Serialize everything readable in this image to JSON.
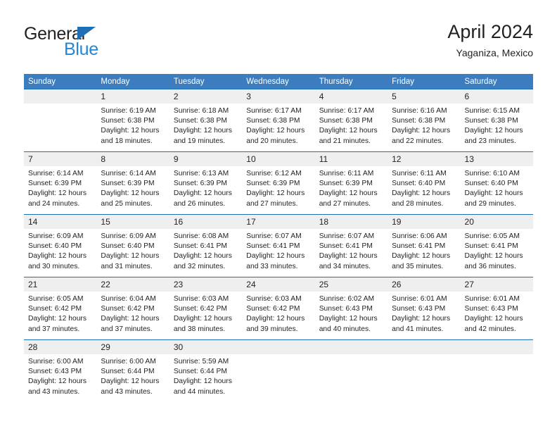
{
  "brand": {
    "name_top": "General",
    "name_bottom": "Blue",
    "triangle_color": "#1f6fb5",
    "blue_text_color": "#2387d6"
  },
  "header": {
    "title": "April 2024",
    "subtitle": "Yaganiza, Mexico"
  },
  "theme": {
    "header_row_bg": "#3b7dbf",
    "week_separator": "#1f6fb5",
    "daynum_bg": "#efefef",
    "text": "#231f20"
  },
  "weekday_headers": [
    "Sunday",
    "Monday",
    "Tuesday",
    "Wednesday",
    "Thursday",
    "Friday",
    "Saturday"
  ],
  "weeks": [
    [
      {
        "day": "",
        "sunrise": "",
        "sunset": "",
        "daylight_line1": "",
        "daylight_line2": ""
      },
      {
        "day": "1",
        "sunrise": "Sunrise: 6:19 AM",
        "sunset": "Sunset: 6:38 PM",
        "daylight_line1": "Daylight: 12 hours",
        "daylight_line2": "and 18 minutes."
      },
      {
        "day": "2",
        "sunrise": "Sunrise: 6:18 AM",
        "sunset": "Sunset: 6:38 PM",
        "daylight_line1": "Daylight: 12 hours",
        "daylight_line2": "and 19 minutes."
      },
      {
        "day": "3",
        "sunrise": "Sunrise: 6:17 AM",
        "sunset": "Sunset: 6:38 PM",
        "daylight_line1": "Daylight: 12 hours",
        "daylight_line2": "and 20 minutes."
      },
      {
        "day": "4",
        "sunrise": "Sunrise: 6:17 AM",
        "sunset": "Sunset: 6:38 PM",
        "daylight_line1": "Daylight: 12 hours",
        "daylight_line2": "and 21 minutes."
      },
      {
        "day": "5",
        "sunrise": "Sunrise: 6:16 AM",
        "sunset": "Sunset: 6:38 PM",
        "daylight_line1": "Daylight: 12 hours",
        "daylight_line2": "and 22 minutes."
      },
      {
        "day": "6",
        "sunrise": "Sunrise: 6:15 AM",
        "sunset": "Sunset: 6:38 PM",
        "daylight_line1": "Daylight: 12 hours",
        "daylight_line2": "and 23 minutes."
      }
    ],
    [
      {
        "day": "7",
        "sunrise": "Sunrise: 6:14 AM",
        "sunset": "Sunset: 6:39 PM",
        "daylight_line1": "Daylight: 12 hours",
        "daylight_line2": "and 24 minutes."
      },
      {
        "day": "8",
        "sunrise": "Sunrise: 6:14 AM",
        "sunset": "Sunset: 6:39 PM",
        "daylight_line1": "Daylight: 12 hours",
        "daylight_line2": "and 25 minutes."
      },
      {
        "day": "9",
        "sunrise": "Sunrise: 6:13 AM",
        "sunset": "Sunset: 6:39 PM",
        "daylight_line1": "Daylight: 12 hours",
        "daylight_line2": "and 26 minutes."
      },
      {
        "day": "10",
        "sunrise": "Sunrise: 6:12 AM",
        "sunset": "Sunset: 6:39 PM",
        "daylight_line1": "Daylight: 12 hours",
        "daylight_line2": "and 27 minutes."
      },
      {
        "day": "11",
        "sunrise": "Sunrise: 6:11 AM",
        "sunset": "Sunset: 6:39 PM",
        "daylight_line1": "Daylight: 12 hours",
        "daylight_line2": "and 27 minutes."
      },
      {
        "day": "12",
        "sunrise": "Sunrise: 6:11 AM",
        "sunset": "Sunset: 6:40 PM",
        "daylight_line1": "Daylight: 12 hours",
        "daylight_line2": "and 28 minutes."
      },
      {
        "day": "13",
        "sunrise": "Sunrise: 6:10 AM",
        "sunset": "Sunset: 6:40 PM",
        "daylight_line1": "Daylight: 12 hours",
        "daylight_line2": "and 29 minutes."
      }
    ],
    [
      {
        "day": "14",
        "sunrise": "Sunrise: 6:09 AM",
        "sunset": "Sunset: 6:40 PM",
        "daylight_line1": "Daylight: 12 hours",
        "daylight_line2": "and 30 minutes."
      },
      {
        "day": "15",
        "sunrise": "Sunrise: 6:09 AM",
        "sunset": "Sunset: 6:40 PM",
        "daylight_line1": "Daylight: 12 hours",
        "daylight_line2": "and 31 minutes."
      },
      {
        "day": "16",
        "sunrise": "Sunrise: 6:08 AM",
        "sunset": "Sunset: 6:41 PM",
        "daylight_line1": "Daylight: 12 hours",
        "daylight_line2": "and 32 minutes."
      },
      {
        "day": "17",
        "sunrise": "Sunrise: 6:07 AM",
        "sunset": "Sunset: 6:41 PM",
        "daylight_line1": "Daylight: 12 hours",
        "daylight_line2": "and 33 minutes."
      },
      {
        "day": "18",
        "sunrise": "Sunrise: 6:07 AM",
        "sunset": "Sunset: 6:41 PM",
        "daylight_line1": "Daylight: 12 hours",
        "daylight_line2": "and 34 minutes."
      },
      {
        "day": "19",
        "sunrise": "Sunrise: 6:06 AM",
        "sunset": "Sunset: 6:41 PM",
        "daylight_line1": "Daylight: 12 hours",
        "daylight_line2": "and 35 minutes."
      },
      {
        "day": "20",
        "sunrise": "Sunrise: 6:05 AM",
        "sunset": "Sunset: 6:41 PM",
        "daylight_line1": "Daylight: 12 hours",
        "daylight_line2": "and 36 minutes."
      }
    ],
    [
      {
        "day": "21",
        "sunrise": "Sunrise: 6:05 AM",
        "sunset": "Sunset: 6:42 PM",
        "daylight_line1": "Daylight: 12 hours",
        "daylight_line2": "and 37 minutes."
      },
      {
        "day": "22",
        "sunrise": "Sunrise: 6:04 AM",
        "sunset": "Sunset: 6:42 PM",
        "daylight_line1": "Daylight: 12 hours",
        "daylight_line2": "and 37 minutes."
      },
      {
        "day": "23",
        "sunrise": "Sunrise: 6:03 AM",
        "sunset": "Sunset: 6:42 PM",
        "daylight_line1": "Daylight: 12 hours",
        "daylight_line2": "and 38 minutes."
      },
      {
        "day": "24",
        "sunrise": "Sunrise: 6:03 AM",
        "sunset": "Sunset: 6:42 PM",
        "daylight_line1": "Daylight: 12 hours",
        "daylight_line2": "and 39 minutes."
      },
      {
        "day": "25",
        "sunrise": "Sunrise: 6:02 AM",
        "sunset": "Sunset: 6:43 PM",
        "daylight_line1": "Daylight: 12 hours",
        "daylight_line2": "and 40 minutes."
      },
      {
        "day": "26",
        "sunrise": "Sunrise: 6:01 AM",
        "sunset": "Sunset: 6:43 PM",
        "daylight_line1": "Daylight: 12 hours",
        "daylight_line2": "and 41 minutes."
      },
      {
        "day": "27",
        "sunrise": "Sunrise: 6:01 AM",
        "sunset": "Sunset: 6:43 PM",
        "daylight_line1": "Daylight: 12 hours",
        "daylight_line2": "and 42 minutes."
      }
    ],
    [
      {
        "day": "28",
        "sunrise": "Sunrise: 6:00 AM",
        "sunset": "Sunset: 6:43 PM",
        "daylight_line1": "Daylight: 12 hours",
        "daylight_line2": "and 43 minutes."
      },
      {
        "day": "29",
        "sunrise": "Sunrise: 6:00 AM",
        "sunset": "Sunset: 6:44 PM",
        "daylight_line1": "Daylight: 12 hours",
        "daylight_line2": "and 43 minutes."
      },
      {
        "day": "30",
        "sunrise": "Sunrise: 5:59 AM",
        "sunset": "Sunset: 6:44 PM",
        "daylight_line1": "Daylight: 12 hours",
        "daylight_line2": "and 44 minutes."
      },
      {
        "day": "",
        "sunrise": "",
        "sunset": "",
        "daylight_line1": "",
        "daylight_line2": ""
      },
      {
        "day": "",
        "sunrise": "",
        "sunset": "",
        "daylight_line1": "",
        "daylight_line2": ""
      },
      {
        "day": "",
        "sunrise": "",
        "sunset": "",
        "daylight_line1": "",
        "daylight_line2": ""
      },
      {
        "day": "",
        "sunrise": "",
        "sunset": "",
        "daylight_line1": "",
        "daylight_line2": ""
      }
    ]
  ]
}
